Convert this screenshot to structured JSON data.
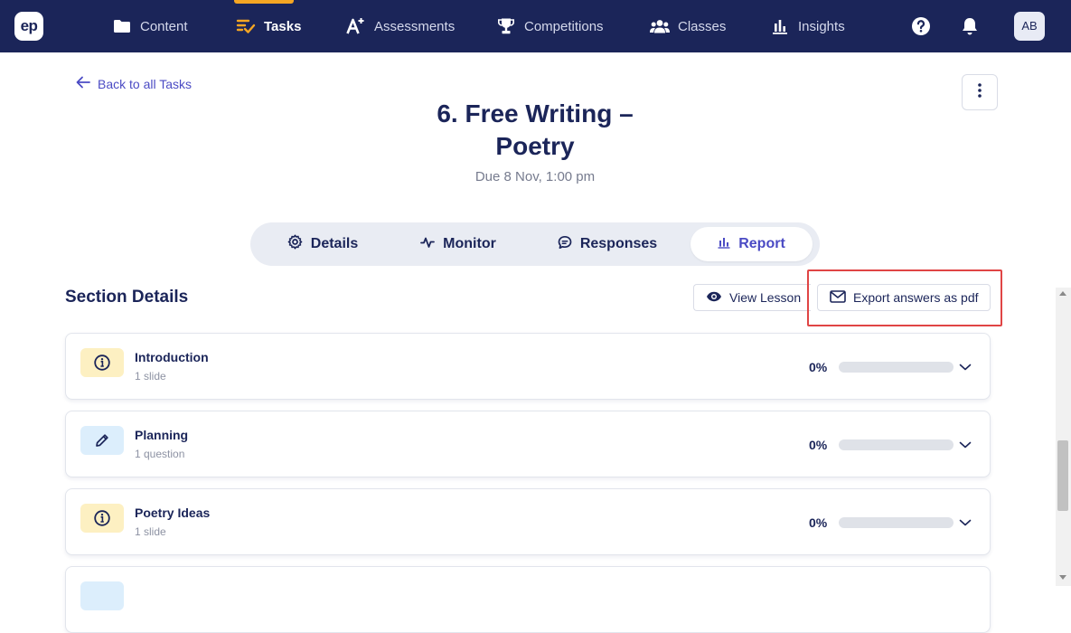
{
  "nav": {
    "logo": "ep",
    "items": [
      {
        "label": "Content",
        "icon": "folder-icon",
        "active": false
      },
      {
        "label": "Tasks",
        "icon": "tasks-icon",
        "active": true
      },
      {
        "label": "Assessments",
        "icon": "a-plus-icon",
        "active": false
      },
      {
        "label": "Competitions",
        "icon": "trophy-icon",
        "active": false
      },
      {
        "label": "Classes",
        "icon": "users-icon",
        "active": false
      },
      {
        "label": "Insights",
        "icon": "bar-chart-icon",
        "active": false
      }
    ],
    "avatar": "AB",
    "accent": "#f5a623",
    "bg": "#1b2559"
  },
  "header": {
    "back_label": "Back to all Tasks",
    "title_line1": "6. Free Writing –",
    "title_line2": "Poetry",
    "due": "Due 8 Nov, 1:00 pm"
  },
  "tabs": [
    {
      "label": "Details",
      "icon": "gear-icon",
      "active": false
    },
    {
      "label": "Monitor",
      "icon": "pulse-icon",
      "active": false
    },
    {
      "label": "Responses",
      "icon": "chat-bubble-icon",
      "active": false
    },
    {
      "label": "Report",
      "icon": "bar-chart-icon",
      "active": true
    }
  ],
  "section": {
    "title": "Section Details",
    "view_lesson": "View Lesson",
    "export_pdf": "Export answers as pdf",
    "highlight_color": "#e04545"
  },
  "cards": [
    {
      "name": "Introduction",
      "sub": "1 slide",
      "pct": "0%",
      "progress": 0,
      "icon": "info-icon",
      "tone": "yellow"
    },
    {
      "name": "Planning",
      "sub": "1 question",
      "pct": "0%",
      "progress": 0,
      "icon": "pencil-icon",
      "tone": "blue"
    },
    {
      "name": "Poetry Ideas",
      "sub": "1 slide",
      "pct": "0%",
      "progress": 0,
      "icon": "info-icon",
      "tone": "yellow"
    }
  ]
}
